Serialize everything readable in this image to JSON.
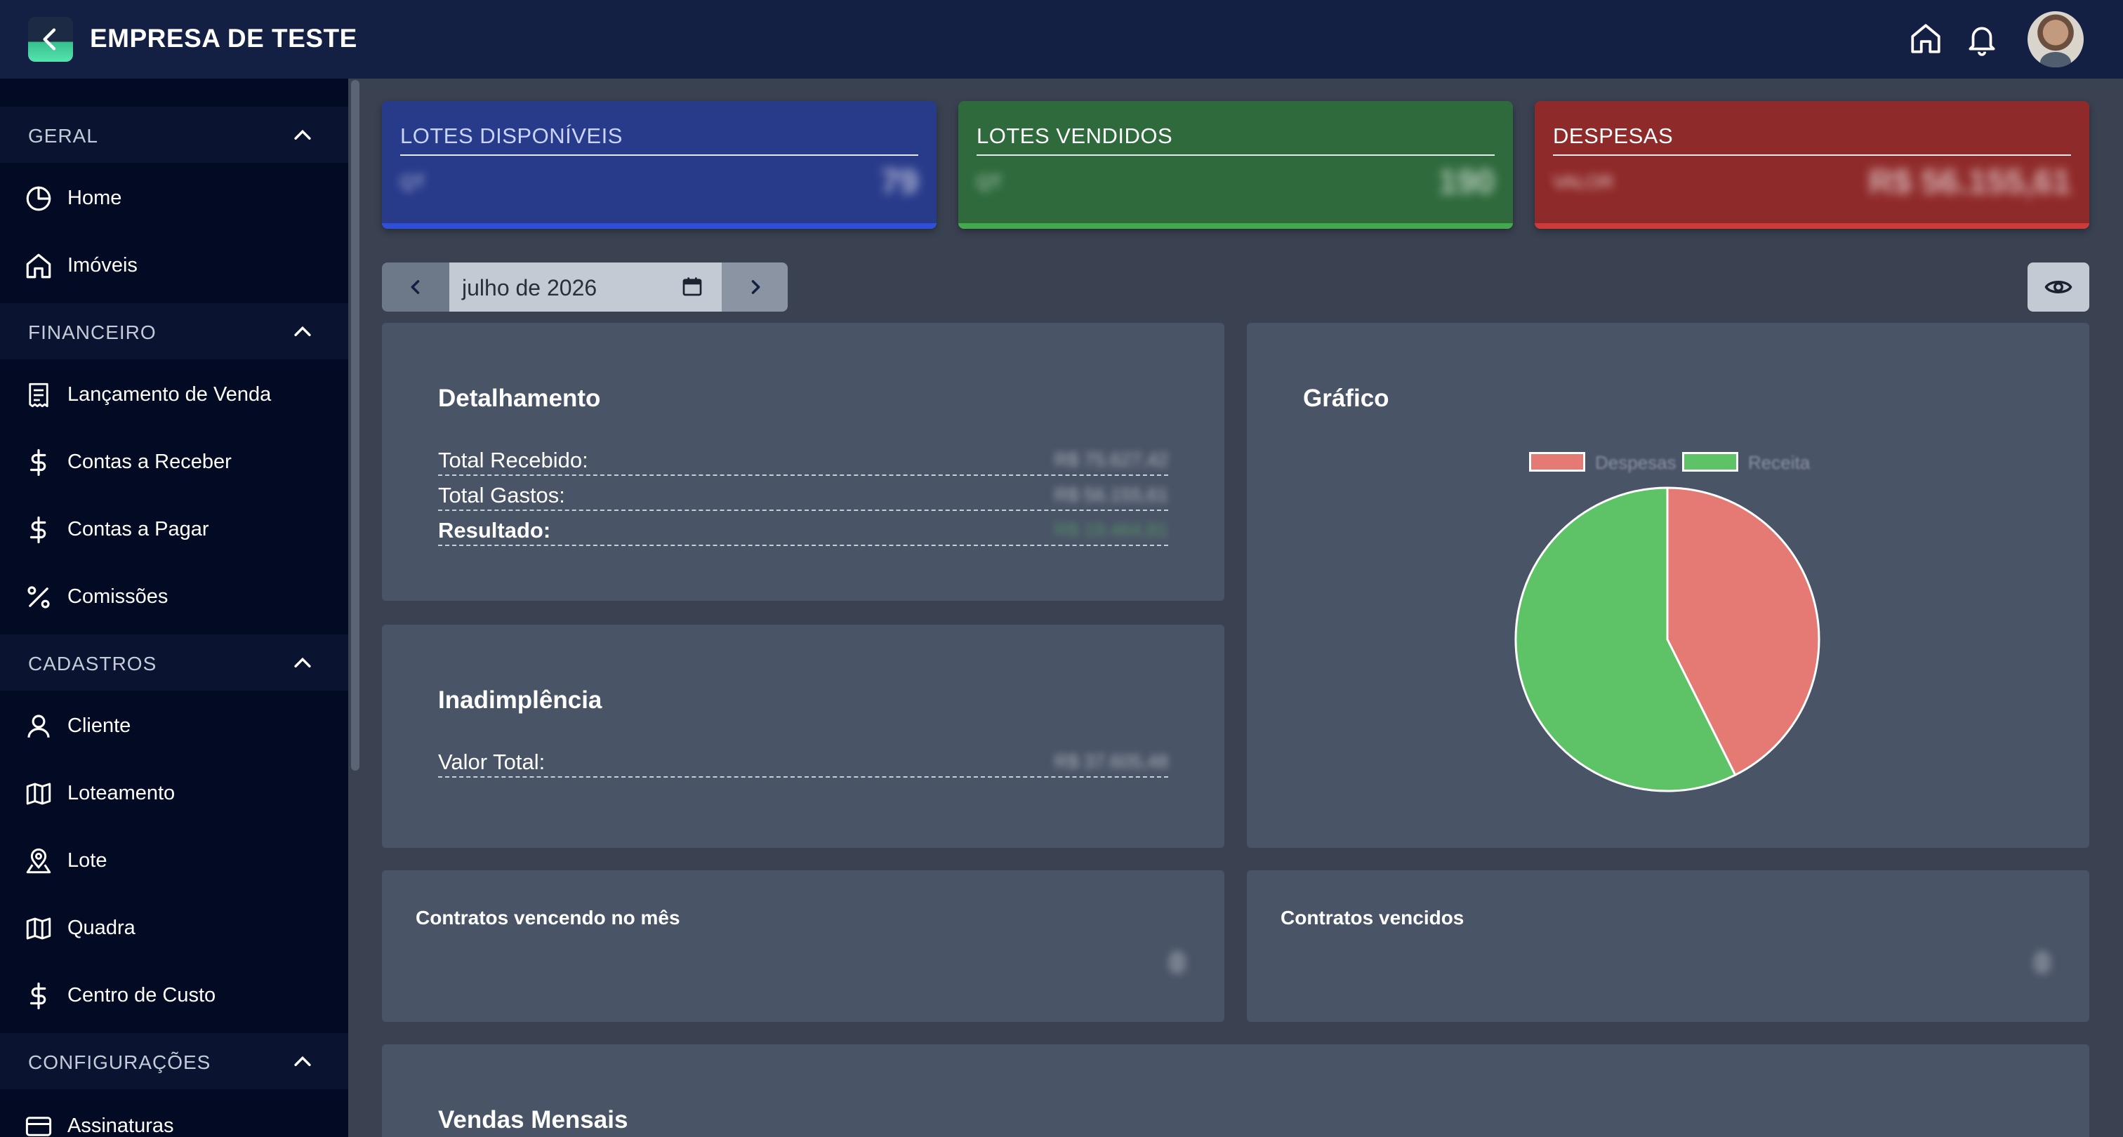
{
  "header": {
    "title": "EMPRESA DE TESTE"
  },
  "sidebar": {
    "sections": [
      {
        "label": "GERAL",
        "items": [
          {
            "label": "Home",
            "icon": "pie-chart-icon"
          },
          {
            "label": "Imóveis",
            "icon": "house-icon"
          }
        ]
      },
      {
        "label": "FINANCEIRO",
        "items": [
          {
            "label": "Lançamento de Venda",
            "icon": "receipt-icon"
          },
          {
            "label": "Contas a Receber",
            "icon": "dollar-icon"
          },
          {
            "label": "Contas a Pagar",
            "icon": "dollar-icon"
          },
          {
            "label": "Comissões",
            "icon": "percent-icon"
          }
        ]
      },
      {
        "label": "CADASTROS",
        "items": [
          {
            "label": "Cliente",
            "icon": "user-icon"
          },
          {
            "label": "Loteamento",
            "icon": "map-icon"
          },
          {
            "label": "Lote",
            "icon": "map-pin-icon"
          },
          {
            "label": "Quadra",
            "icon": "map-icon"
          },
          {
            "label": "Centro de Custo",
            "icon": "dollar-icon"
          }
        ]
      },
      {
        "label": "CONFIGURAÇÕES",
        "items": [
          {
            "label": "Assinaturas",
            "icon": "credit-card-icon"
          }
        ]
      }
    ]
  },
  "stats": [
    {
      "label": "LOTES DISPONÍVEIS",
      "sub": "QT",
      "value": "79",
      "color": "#283a8a",
      "accent": "#2f50d6",
      "label_color": "#c9d4ff"
    },
    {
      "label": "LOTES VENDIDOS",
      "sub": "QT",
      "value": "190",
      "color": "#2e6a3c",
      "accent": "#44a84f",
      "label_color": "#ffffff"
    },
    {
      "label": "DESPESAS",
      "sub": "VALOR",
      "value": "R$ 56.155,61",
      "color": "#8f2a2a",
      "accent": "#cc3a3a",
      "label_color": "#ffffff"
    }
  ],
  "month_picker": {
    "value": "julho de 2026"
  },
  "detalhamento": {
    "title": "Detalhamento",
    "rows": [
      {
        "label": "Total Recebido:",
        "value": "R$ 75.627,42"
      },
      {
        "label": "Total Gastos:",
        "value": "R$ 56.155,61"
      },
      {
        "label": "Resultado:",
        "value": "R$ 19.464,81"
      }
    ]
  },
  "inadimplencia": {
    "title": "Inadimplência",
    "rows": [
      {
        "label": "Valor Total:",
        "value": "R$ 37.605,48"
      }
    ]
  },
  "grafico": {
    "title": "Gráfico",
    "legend": [
      {
        "label": "Despesas",
        "color": "#e57a74"
      },
      {
        "label": "Receita",
        "color": "#5ec266"
      }
    ]
  },
  "chart_data": {
    "type": "pie",
    "categories": [
      "Despesas",
      "Receita"
    ],
    "values": [
      56155.61,
      75627.42
    ],
    "colors": [
      "#e57a74",
      "#5ec266"
    ]
  },
  "contratos_mes": {
    "title": "Contratos vencendo no mês",
    "value": "0"
  },
  "contratos_vencidos": {
    "title": "Contratos vencidos",
    "value": "0"
  },
  "vendas": {
    "title": "Vendas Mensais"
  }
}
